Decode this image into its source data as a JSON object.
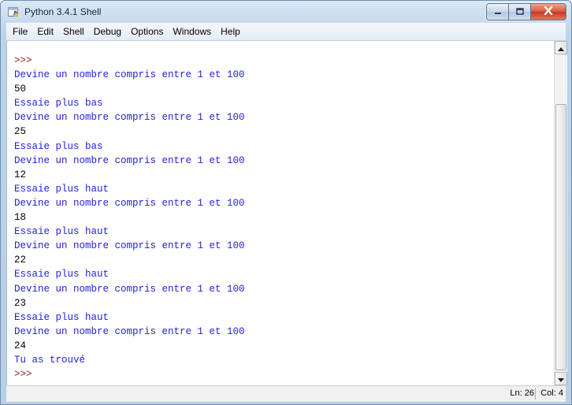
{
  "window": {
    "title": "Python 3.4.1 Shell",
    "icon": "python-idle-icon",
    "controls": [
      "minimize-icon",
      "maximize-icon",
      "close-icon"
    ]
  },
  "menu": [
    "File",
    "Edit",
    "Shell",
    "Debug",
    "Options",
    "Windows",
    "Help"
  ],
  "shell": {
    "lines": [
      {
        "kind": "prompt",
        "text": ">>>"
      },
      {
        "kind": "output",
        "text": "Devine un nombre compris entre 1 et 100"
      },
      {
        "kind": "input",
        "text": "50"
      },
      {
        "kind": "output",
        "text": "Essaie plus bas"
      },
      {
        "kind": "output",
        "text": "Devine un nombre compris entre 1 et 100"
      },
      {
        "kind": "input",
        "text": "25"
      },
      {
        "kind": "output",
        "text": "Essaie plus bas"
      },
      {
        "kind": "output",
        "text": "Devine un nombre compris entre 1 et 100"
      },
      {
        "kind": "input",
        "text": "12"
      },
      {
        "kind": "output",
        "text": "Essaie plus haut"
      },
      {
        "kind": "output",
        "text": "Devine un nombre compris entre 1 et 100"
      },
      {
        "kind": "input",
        "text": "18"
      },
      {
        "kind": "output",
        "text": "Essaie plus haut"
      },
      {
        "kind": "output",
        "text": "Devine un nombre compris entre 1 et 100"
      },
      {
        "kind": "input",
        "text": "22"
      },
      {
        "kind": "output",
        "text": "Essaie plus haut"
      },
      {
        "kind": "output",
        "text": "Devine un nombre compris entre 1 et 100"
      },
      {
        "kind": "input",
        "text": "23"
      },
      {
        "kind": "output",
        "text": "Essaie plus haut"
      },
      {
        "kind": "output",
        "text": "Devine un nombre compris entre 1 et 100"
      },
      {
        "kind": "input",
        "text": "24"
      },
      {
        "kind": "output",
        "text": "Tu as trouvé"
      },
      {
        "kind": "prompt",
        "text": ">>>"
      }
    ]
  },
  "status": {
    "line": "Ln: 26",
    "col": "Col: 4"
  },
  "colors": {
    "prompt": "#8b1a1a",
    "output": "#2323d8",
    "input": "#000000",
    "close_button": "#c6391f"
  }
}
